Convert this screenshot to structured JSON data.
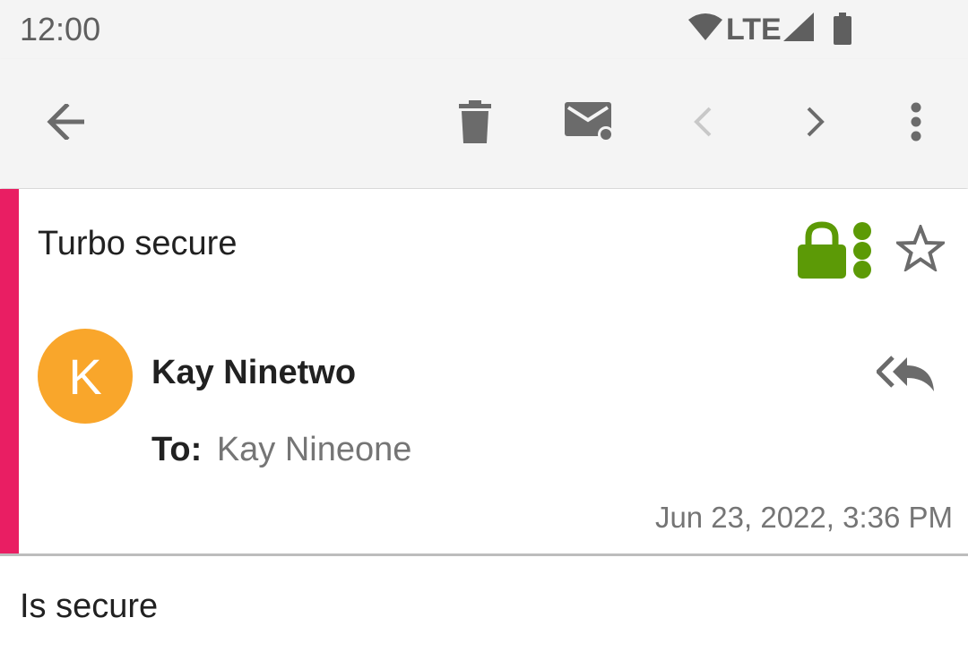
{
  "status_bar": {
    "time": "12:00",
    "network_label": "LTE",
    "icons": [
      "wifi-icon",
      "signal-icon",
      "battery-icon"
    ]
  },
  "toolbar": {
    "icons": [
      "back-arrow-icon",
      "trash-icon",
      "mark-unread-icon",
      "previous-chevron-icon",
      "next-chevron-icon",
      "more-vert-icon"
    ]
  },
  "message": {
    "subject": "Turbo secure",
    "sender_name": "Kay Ninetwo",
    "avatar_initial": "K",
    "to_label": "To:",
    "to_value": "Kay Nineone",
    "date": "Jun 23, 2022, 3:36 PM",
    "body": "Is secure"
  },
  "colors": {
    "accent": "#e91e63",
    "security_green": "#5c9a06",
    "avatar": "#f9a62b",
    "toolbar_bg": "#f4f4f4",
    "icon_grey": "#6b6b6b"
  }
}
